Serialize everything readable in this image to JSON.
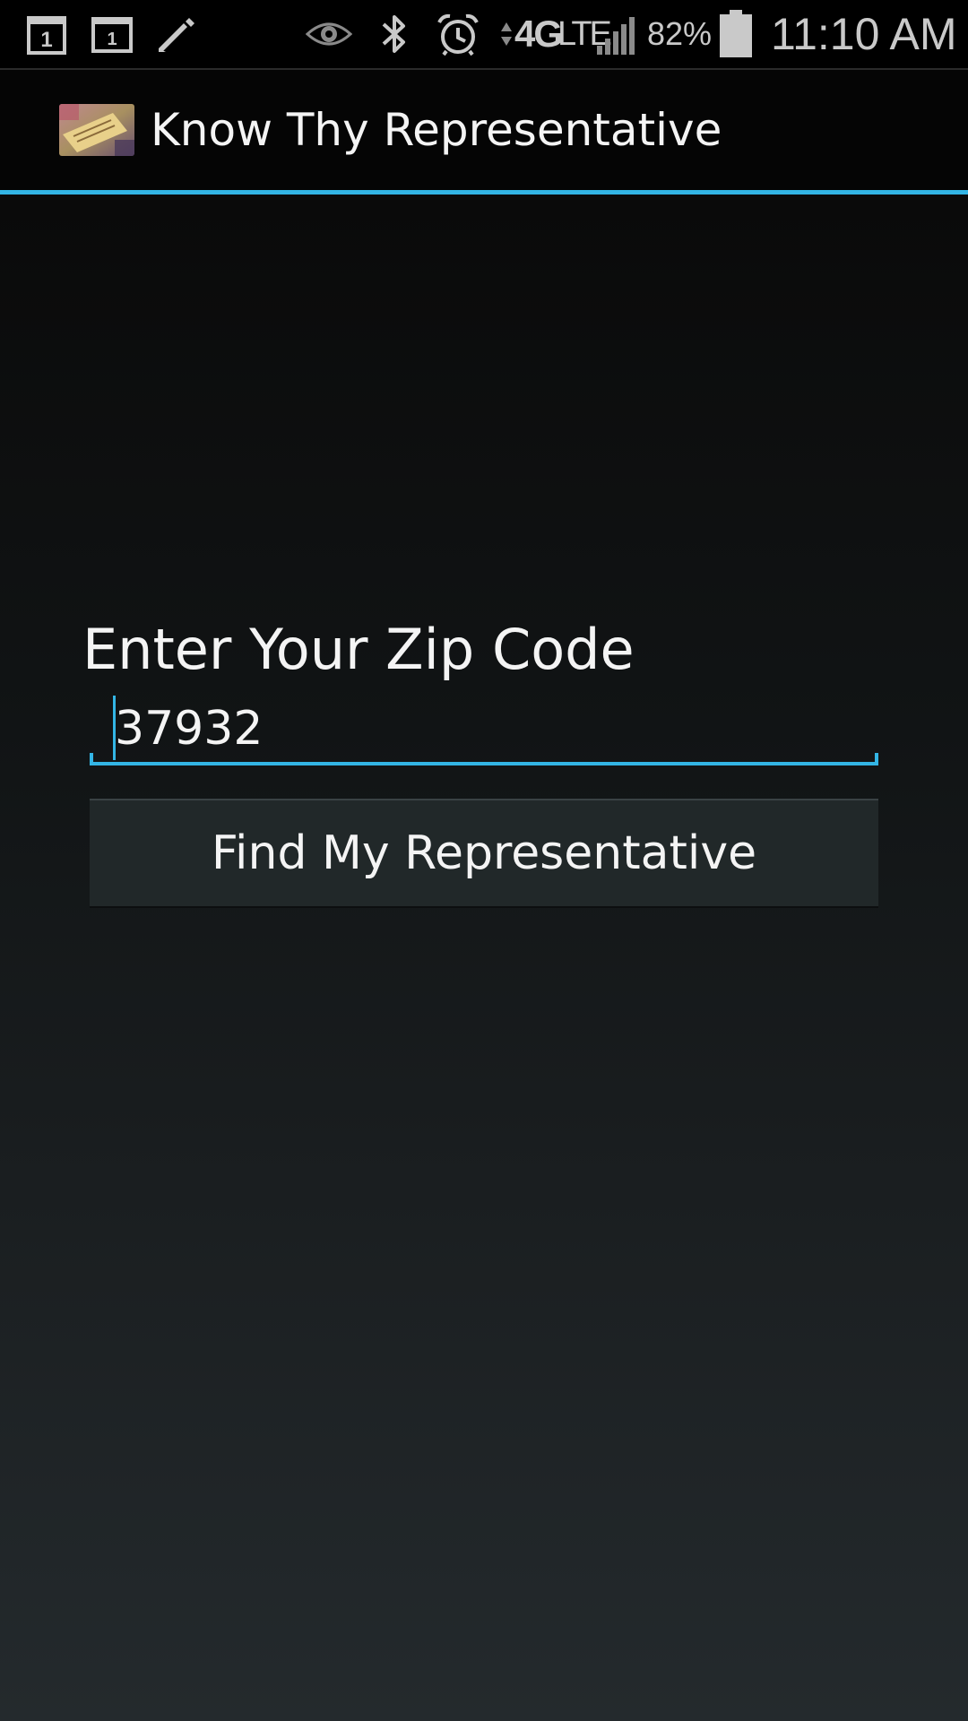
{
  "status_bar": {
    "calendar_day_1": "1",
    "calendar_day_2": "1",
    "network_badge": "4G",
    "network_type": "LTE",
    "battery_percent": "82%",
    "time": "11:10 AM",
    "icons": [
      "calendar-icon",
      "calendar-icon",
      "pencil-icon",
      "eye-icon",
      "bluetooth-icon",
      "alarm-clock-icon",
      "data-arrows-icon",
      "signal-strength-icon",
      "battery-icon"
    ]
  },
  "action_bar": {
    "title": "Know Thy Representative",
    "icon": "app-logo-icon",
    "accent_color": "#33b5e5"
  },
  "form": {
    "zip_label": "Enter Your Zip Code",
    "zip_value": "37932",
    "submit_label": "Find My Representative"
  }
}
